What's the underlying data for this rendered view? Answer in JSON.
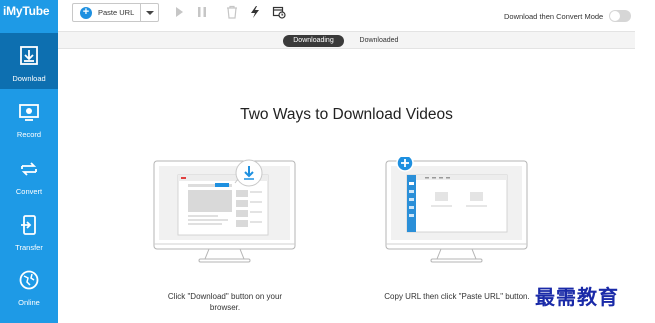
{
  "app": {
    "logo_text": "iMyTube"
  },
  "sidebar": {
    "items": [
      {
        "label": "Download",
        "icon": "download-icon",
        "active": true
      },
      {
        "label": "Record",
        "icon": "record-icon",
        "active": false
      },
      {
        "label": "Convert",
        "icon": "convert-icon",
        "active": false
      },
      {
        "label": "Transfer",
        "icon": "transfer-icon",
        "active": false
      },
      {
        "label": "Online",
        "icon": "online-icon",
        "active": false
      }
    ]
  },
  "toolbar": {
    "paste_label": "Paste URL",
    "mode_label": "Download then Convert Mode",
    "mode_enabled": false
  },
  "tabs": [
    {
      "label": "Downloading",
      "active": true
    },
    {
      "label": "Downloaded",
      "active": false
    }
  ],
  "main": {
    "title": "Two Ways to Download Videos",
    "way1_caption_line1": "Click \"Download\" button on your",
    "way1_caption_line2": "browser.",
    "way2_caption": "Copy URL then click \"Paste URL\" button."
  },
  "watermark": "最需教育",
  "colors": {
    "sidebar": "#1e9ae6",
    "sidebar_active": "#0d6fb0",
    "accent": "#1e90e0",
    "tab_active": "#3a3a3a"
  }
}
